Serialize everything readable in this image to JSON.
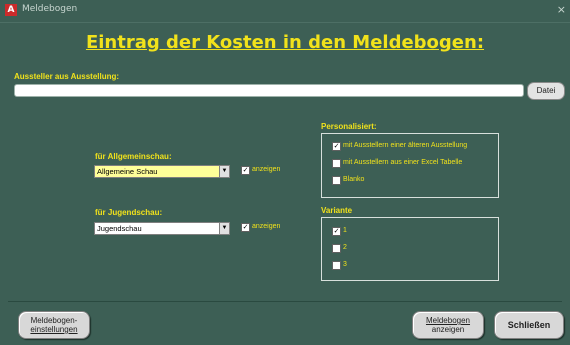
{
  "window": {
    "title": "Meldebogen",
    "icon_letter": "A",
    "close": "×"
  },
  "heading": "Eintrag der Kosten in den Meldebogen:",
  "aussteller": {
    "label": "Aussteller aus Ausstellung:",
    "value": "",
    "datei_button": "Datei"
  },
  "allgemeinschau": {
    "label": "für Allgemeinschau:",
    "value": "Allgemeine Schau",
    "anzeigen": "anzeigen",
    "anzeigen_checked": true
  },
  "jugendschau": {
    "label": "für Jugendschau:",
    "value": "Jugendschau",
    "anzeigen": "anzeigen",
    "anzeigen_checked": true
  },
  "personalisiert": {
    "label": "Personalisiert:",
    "options": [
      {
        "label": "mit Ausstellern einer älteren Ausstellung",
        "checked": true
      },
      {
        "label": "mit Ausstellern aus einer Excel Tabelle",
        "checked": false
      },
      {
        "label": "Blanko",
        "checked": false
      }
    ]
  },
  "variante": {
    "label": "Variante",
    "options": [
      {
        "label": "1",
        "checked": true
      },
      {
        "label": "2",
        "checked": false
      },
      {
        "label": "3",
        "checked": false
      }
    ]
  },
  "footer": {
    "einstellungen_line1": "Meldebogen-",
    "einstellungen_line2": "einstellungen",
    "anzeigen_line1": "Meldebogen",
    "anzeigen_line2": "anzeigen",
    "schliessen": "Schließen"
  },
  "colors": {
    "background": "#3d5f55",
    "label_yellow": "#f1e21b",
    "combo_selected": "#ffff99"
  }
}
